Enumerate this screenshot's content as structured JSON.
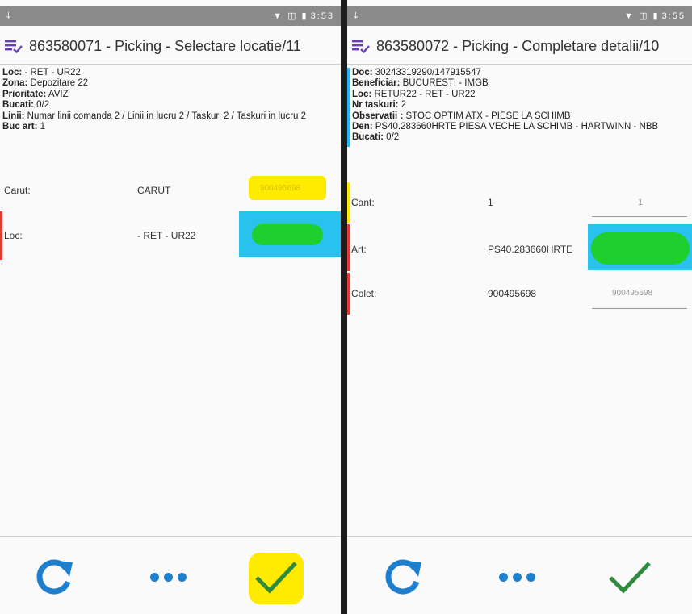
{
  "colors": {
    "accent_blue": "#1e7fcf",
    "check_green": "#2e8b3d",
    "menu_purple": "#6a3fb0",
    "highlight_yellow": "#ffeb00",
    "highlight_cyan": "#29c2ee",
    "highlight_green": "#1fcf2d"
  },
  "left": {
    "status": {
      "time": "3:53",
      "download_icon": "download-icon"
    },
    "title": "863580071 - Picking - Selectare locatie/11",
    "info": [
      {
        "key": "Loc:",
        "value": " - RET - UR22"
      },
      {
        "key": "Zona:",
        "value": " Depozitare 22"
      },
      {
        "key": "Prioritate:",
        "value": " AVIZ"
      },
      {
        "key": "Bucati:",
        "value": " 0/2"
      },
      {
        "key": "Linii:",
        "value": " Numar linii comanda 2 / Linii in lucru 2 / Taskuri 2 / Taskuri in lucru 2"
      },
      {
        "key": "Buc art:",
        "value": " 1"
      }
    ],
    "rows": {
      "carut": {
        "label": "Carut:",
        "value": "CARUT",
        "field": "900495698"
      },
      "loc": {
        "label": "Loc:",
        "value": "- RET - UR22",
        "field": ""
      }
    },
    "footer": {
      "refresh": "refresh-icon",
      "more": "more-icon",
      "confirm": "check-icon"
    }
  },
  "right": {
    "status": {
      "time": "3:55",
      "download_icon": "download-icon"
    },
    "title": "863580072 - Picking - Completare detalii/10",
    "info": [
      {
        "key": "Doc:",
        "value": " 30243319290/147915547"
      },
      {
        "key": "Beneficiar:",
        "value": " BUCURESTI - IMGB"
      },
      {
        "key": "Loc:",
        "value": " RETUR22 - RET - UR22"
      },
      {
        "key": "Nr taskuri:",
        "value": " 2"
      },
      {
        "key": "Observatii :",
        "value": " STOC OPTIM ATX - PIESE LA SCHIMB"
      },
      {
        "key": "Den:",
        "value": " PS40.283660HRTE PIESA VECHE LA SCHIMB - HARTWINN - NBB"
      },
      {
        "key": "Bucati:",
        "value": " 0/2"
      }
    ],
    "rows": {
      "cant": {
        "label": "Cant:",
        "value": "1",
        "field": "1"
      },
      "art": {
        "label": "Art:",
        "value": "PS40.283660HRTE",
        "field": ""
      },
      "colet": {
        "label": "Colet:",
        "value": "900495698",
        "field": "900495698"
      }
    },
    "footer": {
      "refresh": "refresh-icon",
      "more": "more-icon",
      "confirm": "check-icon"
    }
  }
}
